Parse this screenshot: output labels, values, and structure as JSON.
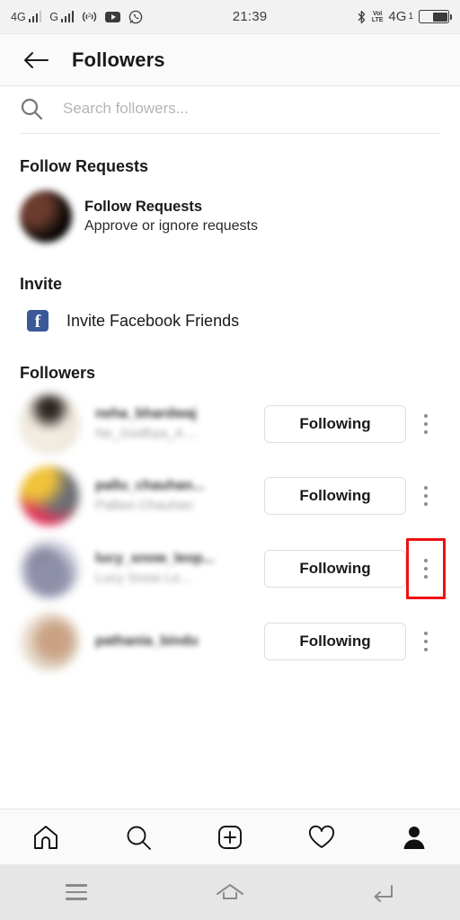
{
  "status_bar": {
    "network_1": "4G",
    "network_2": "G",
    "time": "21:39",
    "volte": "VoI LTE",
    "network_right": "4G",
    "network_right_sub": "1",
    "icons": [
      "signal-bars-icon",
      "signal-bars-icon",
      "hotspot-icon",
      "youtube-icon",
      "whatsapp-icon",
      "bluetooth-icon",
      "volte-icon",
      "battery-icon"
    ]
  },
  "header": {
    "back_icon": "arrow-left-icon",
    "title": "Followers"
  },
  "search": {
    "icon": "search-icon",
    "placeholder": "Search followers...",
    "value": ""
  },
  "sections": {
    "follow_requests_heading": "Follow Requests",
    "invite_heading": "Invite",
    "followers_heading": "Followers"
  },
  "follow_requests": {
    "title": "Follow Requests",
    "subtitle": "Approve or ignore requests",
    "avatar": "blurred-collage-avatar"
  },
  "invite": {
    "icon": "facebook-icon",
    "label": "Invite Facebook Friends"
  },
  "followers": [
    {
      "username": "neha_bhardwaj",
      "fullname": "Ne_Godhya_A ...",
      "action_label": "Following",
      "menu_icon": "kebab-menu-icon",
      "avatar": "blurred-avatar-cream",
      "highlighted": false
    },
    {
      "username": "pallu_chauhan...",
      "fullname": "Pallavi Chauhan",
      "action_label": "Following",
      "menu_icon": "kebab-menu-icon",
      "avatar": "blurred-avatar-warm",
      "highlighted": false
    },
    {
      "username": "lucy_snow_leop...",
      "fullname": "Lucy Snow Le...",
      "action_label": "Following",
      "menu_icon": "kebab-menu-icon",
      "avatar": "blurred-avatar-mountain",
      "highlighted": true
    },
    {
      "username": "pathania_bindu",
      "fullname": "",
      "action_label": "Following",
      "menu_icon": "kebab-menu-icon",
      "avatar": "blurred-avatar-light",
      "highlighted": false
    }
  ],
  "tabbar": {
    "items": [
      {
        "name": "home-icon",
        "active": false
      },
      {
        "name": "search-icon",
        "active": false
      },
      {
        "name": "add-post-icon",
        "active": false
      },
      {
        "name": "heart-icon",
        "active": false
      },
      {
        "name": "profile-icon",
        "active": true
      }
    ]
  },
  "android_nav": {
    "items": [
      "recents-icon",
      "home-icon",
      "back-icon"
    ]
  },
  "colors": {
    "accent_red": "#ee1111",
    "facebook_blue": "#3b5998",
    "text_primary": "#1a1a1a",
    "text_muted": "#9a9a9a",
    "border": "#dedede",
    "chrome_bg": "#fafafa",
    "nav_bg": "#e6e6e6"
  }
}
